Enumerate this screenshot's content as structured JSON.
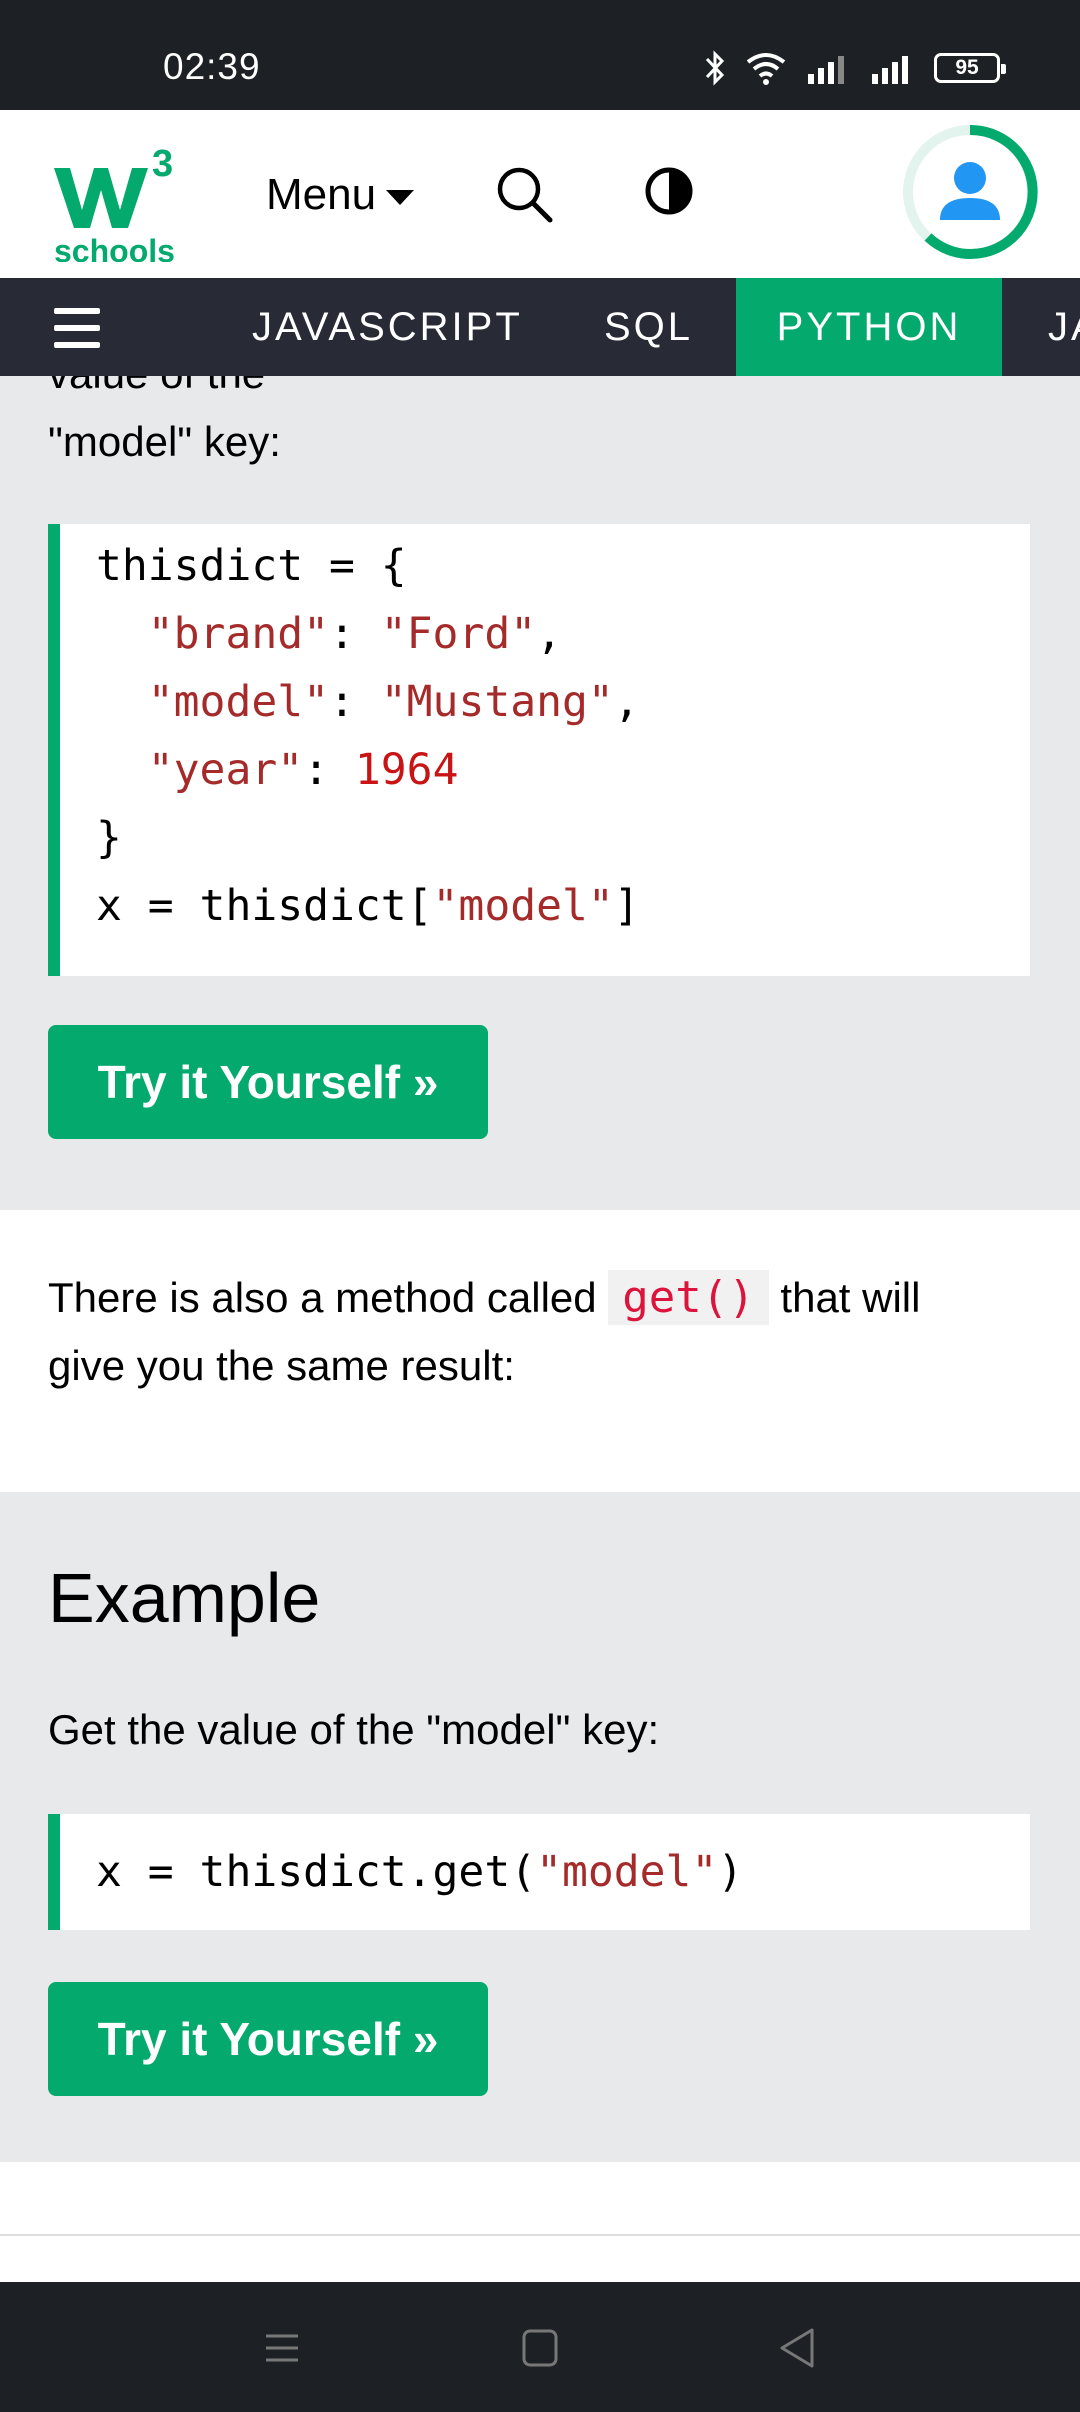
{
  "status_bar": {
    "time": "02:39",
    "battery": "95"
  },
  "header": {
    "logo_text": "schools",
    "logo_superscript": "3",
    "menu_label": "Menu"
  },
  "nav": {
    "items": [
      {
        "label": "JAVASCRIPT"
      },
      {
        "label": "SQL"
      },
      {
        "label": "PYTHON",
        "active": true
      },
      {
        "label": "JA"
      }
    ]
  },
  "section1": {
    "partial_text": "value of the",
    "text": "\"model\" key:",
    "code": {
      "line1_var": "thisdict = {",
      "line2_key": "\"brand\"",
      "line2_val": "\"Ford\"",
      "line3_key": "\"model\"",
      "line3_val": "\"Mustang\"",
      "line4_key": "\"year\"",
      "line4_val": "1964",
      "line5": "}",
      "line6_pre": "x = thisdict[",
      "line6_str": "\"model\"",
      "line6_post": "]"
    },
    "button": "Try it Yourself »"
  },
  "section2": {
    "text_before": "There is also a method called",
    "code": "get()",
    "text_after": "that will",
    "text_line2": "give you the same result:"
  },
  "section3": {
    "heading": "Example",
    "text": "Get the value of the \"model\" key:",
    "code_pre": "x = thisdict.get(",
    "code_str": "\"model\"",
    "code_post": ")",
    "button": "Try it Yourself »"
  },
  "colors": {
    "brand_green": "#04aa6d",
    "nav_dark": "#282a35",
    "code_string": "#a52a2a",
    "code_number": "#c81414",
    "inline_code": "#dc143c"
  }
}
